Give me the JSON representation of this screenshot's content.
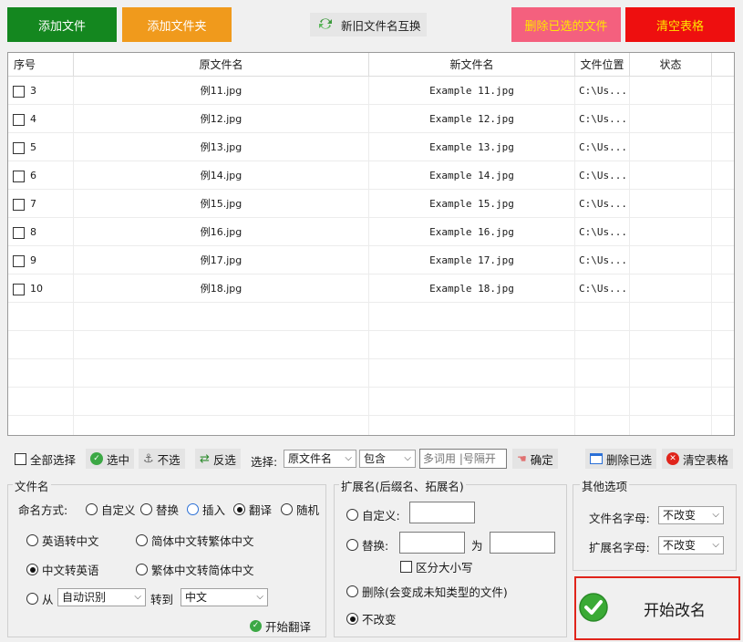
{
  "toolbar": {
    "add_file": "添加文件",
    "add_folder": "添加文件夹",
    "swap_names": "新旧文件名互换",
    "delete_selected": "删除已选的文件",
    "clear_table": "清空表格"
  },
  "table": {
    "headers": {
      "index": "序号",
      "original": "原文件名",
      "new": "新文件名",
      "location": "文件位置",
      "status": "状态"
    },
    "rows": [
      {
        "index": "3",
        "original": "例11.jpg",
        "new": "Example 11.jpg",
        "location": "C:\\Us...",
        "status": ""
      },
      {
        "index": "4",
        "original": "例12.jpg",
        "new": "Example 12.jpg",
        "location": "C:\\Us...",
        "status": ""
      },
      {
        "index": "5",
        "original": "例13.jpg",
        "new": "Example 13.jpg",
        "location": "C:\\Us...",
        "status": ""
      },
      {
        "index": "6",
        "original": "例14.jpg",
        "new": "Example 14.jpg",
        "location": "C:\\Us...",
        "status": ""
      },
      {
        "index": "7",
        "original": "例15.jpg",
        "new": "Example 15.jpg",
        "location": "C:\\Us...",
        "status": ""
      },
      {
        "index": "8",
        "original": "例16.jpg",
        "new": "Example 16.jpg",
        "location": "C:\\Us...",
        "status": ""
      },
      {
        "index": "9",
        "original": "例17.jpg",
        "new": "Example 17.jpg",
        "location": "C:\\Us...",
        "status": ""
      },
      {
        "index": "10",
        "original": "例18.jpg",
        "new": "Example 18.jpg",
        "location": "C:\\Us...",
        "status": ""
      }
    ]
  },
  "selection_bar": {
    "select_all": "全部选择",
    "select": "选中",
    "unselect": "不选",
    "invert": "反选",
    "select_label": "选择:",
    "field_value": "原文件名",
    "match_value": "包含",
    "keyword_placeholder": "多词用 |号隔开",
    "confirm": "确定",
    "delete_selected": "删除已选",
    "clear_table": "清空表格"
  },
  "filename_panel": {
    "title": "文件名",
    "mode_label": "命名方式:",
    "modes": [
      "自定义",
      "替换",
      "插入",
      "翻译",
      "随机"
    ],
    "options": {
      "en_to_zh": "英语转中文",
      "s_to_t": "简体中文转繁体中文",
      "zh_to_en": "中文转英语",
      "t_to_s": "繁体中文转简体中文",
      "from": "从",
      "from_value": "自动识别",
      "to_label": "转到",
      "to_value": "中文"
    },
    "start_translate": "开始翻译"
  },
  "extension_panel": {
    "title": "扩展名(后缀名、拓展名)",
    "custom": "自定义:",
    "replace": "替换:",
    "as_label": "为",
    "case_sensitive": "区分大小写",
    "delete": "删除(会变成未知类型的文件)",
    "unchanged": "不改变"
  },
  "other_panel": {
    "title": "其他选项",
    "filename_case_label": "文件名字母:",
    "filename_case_value": "不改变",
    "ext_case_label": "扩展名字母:",
    "ext_case_value": "不改变"
  },
  "start_rename": "开始改名",
  "colors": {
    "green_button": "#14871f",
    "orange_button": "#f09a1c",
    "pink_button": "#f4607e",
    "red_button": "#ee0f0f",
    "highlight_border": "#e0241b"
  }
}
